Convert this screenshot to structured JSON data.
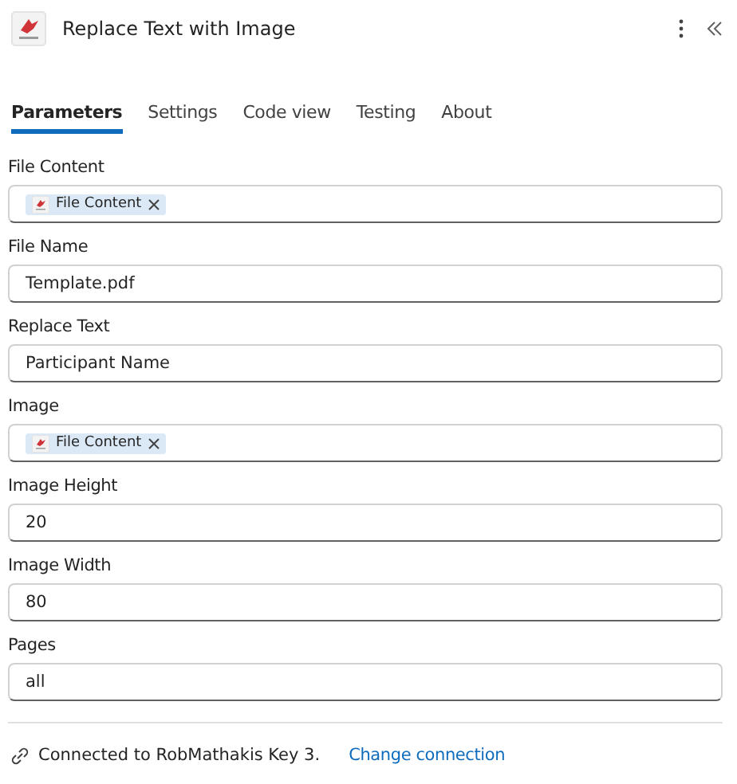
{
  "header": {
    "title": "Replace Text with Image"
  },
  "tabs": [
    {
      "label": "Parameters",
      "selected": true
    },
    {
      "label": "Settings",
      "selected": false
    },
    {
      "label": "Code view",
      "selected": false
    },
    {
      "label": "Testing",
      "selected": false
    },
    {
      "label": "About",
      "selected": false
    }
  ],
  "fields": [
    {
      "label": "File Content",
      "kind": "token",
      "value": "File Content"
    },
    {
      "label": "File Name",
      "kind": "text",
      "value": "Template.pdf"
    },
    {
      "label": "Replace Text",
      "kind": "text",
      "value": "Participant Name"
    },
    {
      "label": "Image",
      "kind": "token",
      "value": "File Content"
    },
    {
      "label": "Image Height",
      "kind": "text",
      "value": "20"
    },
    {
      "label": "Image Width",
      "kind": "text",
      "value": "80"
    },
    {
      "label": "Pages",
      "kind": "text",
      "value": "all"
    }
  ],
  "connection": {
    "text": "Connected to RobMathakis Key 3.",
    "link": "Change connection"
  }
}
